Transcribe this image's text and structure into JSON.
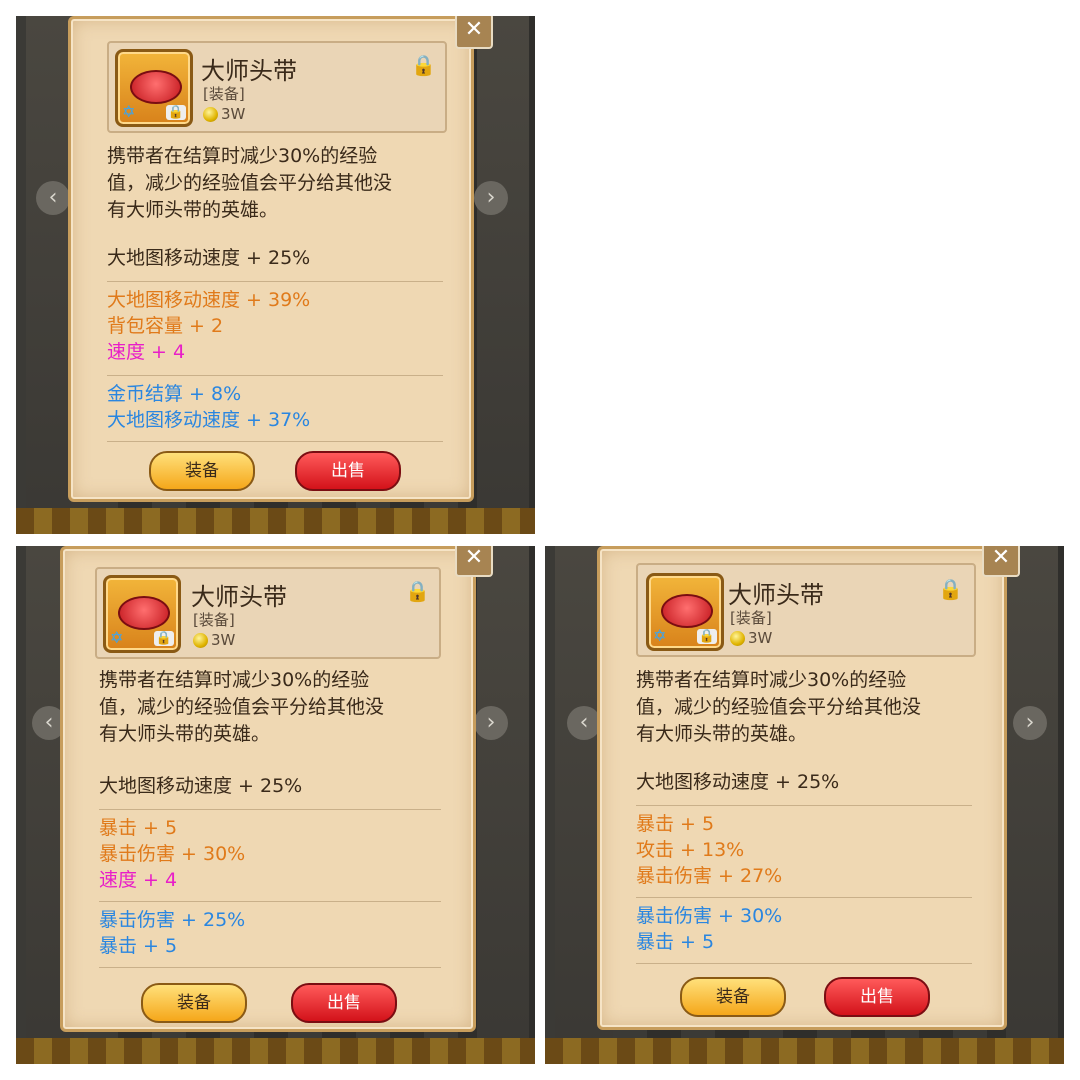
{
  "cards": [
    {
      "item": {
        "name": "大师头带",
        "type": "[装备]",
        "price": "3W"
      },
      "description": [
        "携带者在结算时减少30%的经验",
        "值，减少的经验值会平分给其他没",
        "有大师头带的英雄。"
      ],
      "base_stat": "大地图移动速度 + 25%",
      "group1": [
        {
          "text": "大地图移动速度 + 39%",
          "color": "orange"
        },
        {
          "text": "背包容量 + 2",
          "color": "orange"
        },
        {
          "text": "速度 + 4",
          "color": "pink"
        }
      ],
      "group2": [
        {
          "text": "金币结算 + 8%",
          "color": "blue"
        },
        {
          "text": "大地图移动速度 + 37%",
          "color": "blue"
        }
      ],
      "buttons": {
        "equip": "装备",
        "sell": "出售"
      }
    },
    {
      "item": {
        "name": "大师头带",
        "type": "[装备]",
        "price": "3W"
      },
      "description": [
        "携带者在结算时减少30%的经验",
        "值，减少的经验值会平分给其他没",
        "有大师头带的英雄。"
      ],
      "base_stat": "大地图移动速度 + 25%",
      "group1": [
        {
          "text": "暴击 + 5",
          "color": "orange"
        },
        {
          "text": "暴击伤害 + 30%",
          "color": "orange"
        },
        {
          "text": "速度 + 4",
          "color": "pink"
        }
      ],
      "group2": [
        {
          "text": "暴击伤害 + 25%",
          "color": "blue"
        },
        {
          "text": "暴击 + 5",
          "color": "blue"
        }
      ],
      "buttons": {
        "equip": "装备",
        "sell": "出售"
      }
    },
    {
      "item": {
        "name": "大师头带",
        "type": "[装备]",
        "price": "3W"
      },
      "description": [
        "携带者在结算时减少30%的经验",
        "值，减少的经验值会平分给其他没",
        "有大师头带的英雄。"
      ],
      "base_stat": "大地图移动速度 + 25%",
      "group1": [
        {
          "text": "暴击 + 5",
          "color": "orange"
        },
        {
          "text": "攻击 + 13%",
          "color": "orange"
        },
        {
          "text": "暴击伤害 + 27%",
          "color": "orange"
        }
      ],
      "group2": [
        {
          "text": "暴击伤害 + 30%",
          "color": "blue"
        },
        {
          "text": "暴击 + 5",
          "color": "blue"
        }
      ],
      "buttons": {
        "equip": "装备",
        "sell": "出售"
      }
    }
  ],
  "icons": {
    "close": "close-x-icon",
    "lock": "lock-icon",
    "coin": "coin-icon",
    "star": "star-badge-icon"
  },
  "colors": {
    "orange": "#e07a1a",
    "pink": "#e81ec8",
    "blue": "#2a86e0",
    "panel": "#efd8b3"
  }
}
